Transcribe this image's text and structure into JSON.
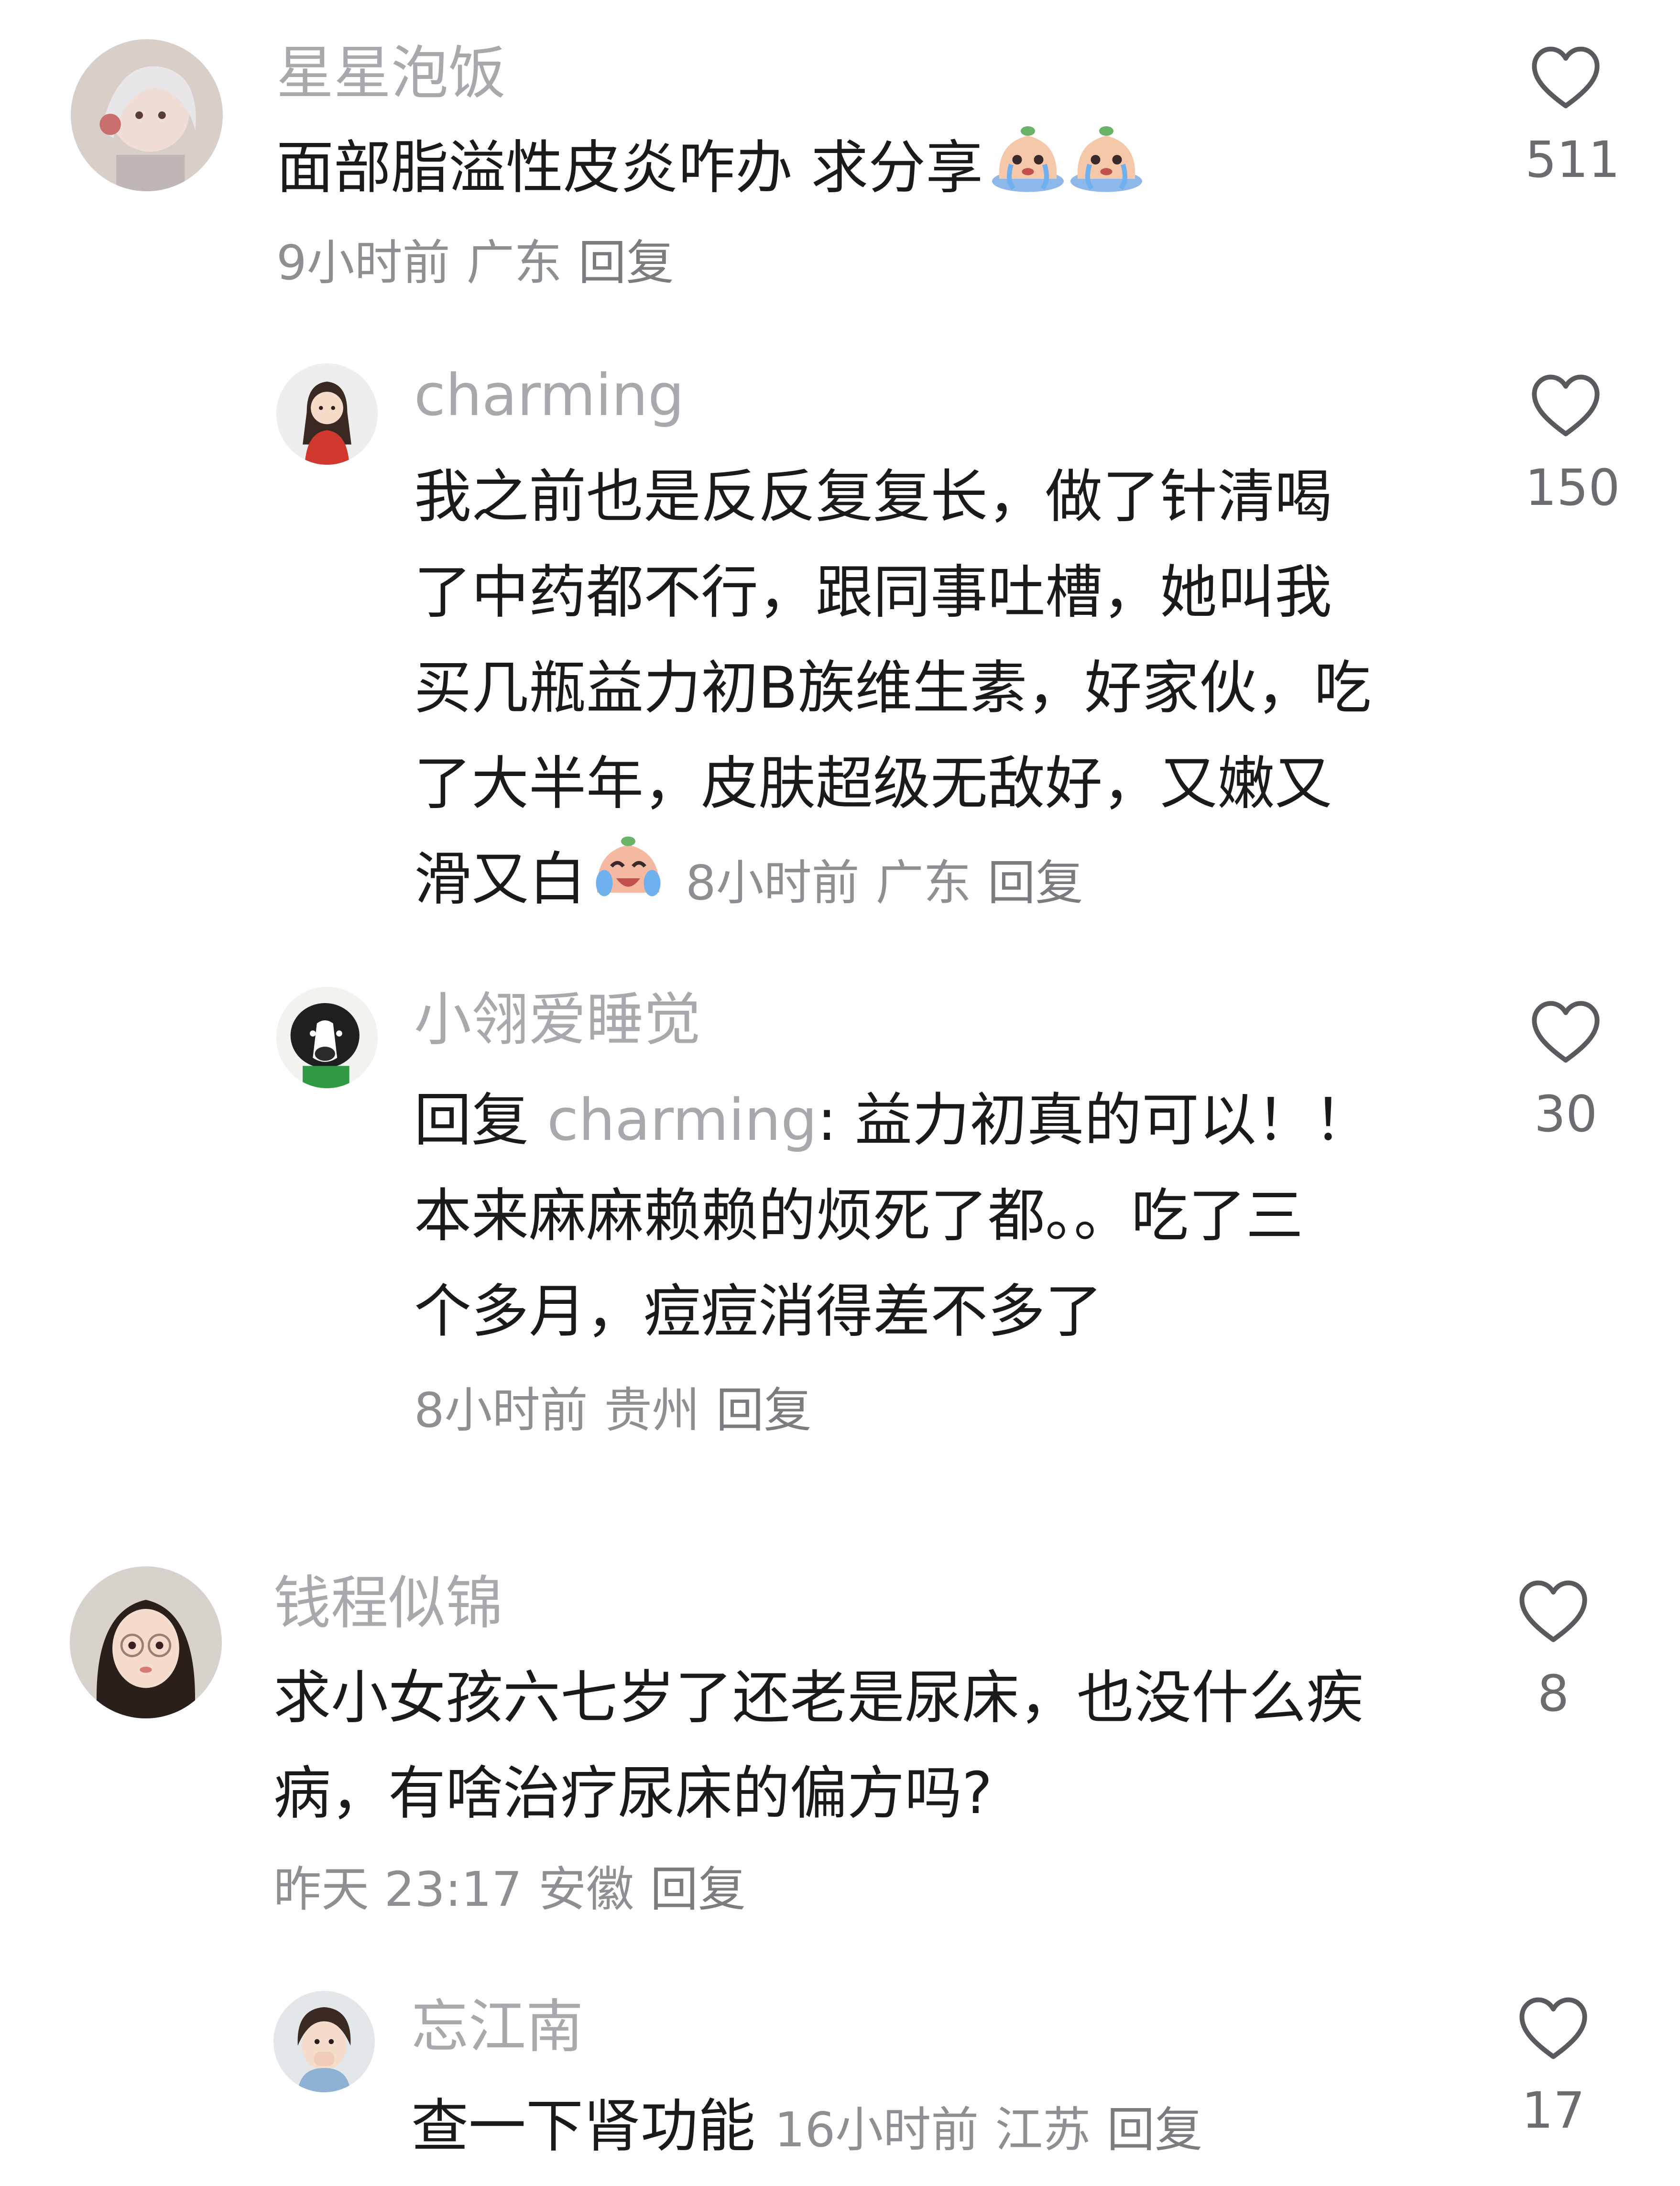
{
  "comments": [
    {
      "username": "星星泡饭",
      "text_lines": [
        "面部脂溢性皮炎咋办 求分享"
      ],
      "emoji": [
        "crying-emoji",
        "crying-emoji"
      ],
      "time": "9小时前",
      "location": "广东",
      "reply_label": "回复",
      "likes": "511"
    },
    {
      "username": "charming",
      "text_lines": [
        "我之前也是反反复复长，做了针清喝",
        "了中药都不行，跟同事吐槽，她叫我",
        "买几瓶益力初B族维生素，好家伙，吃",
        "了大半年，皮肤超级无敌好，又嫩又",
        "滑又白"
      ],
      "emoji": [
        "laugh-cry-emoji"
      ],
      "time": "8小时前",
      "location": "广东",
      "reply_label": "回复",
      "likes": "150"
    },
    {
      "username": "小翎爱睡觉",
      "reply_prefix": "回复",
      "reply_to": "charming",
      "text_lines": [
        ": 益力初真的可以！！",
        "本来麻麻赖赖的烦死了都。。吃了三",
        "个多月，痘痘消得差不多了"
      ],
      "time": "8小时前",
      "location": "贵州",
      "reply_label": "回复",
      "likes": "30"
    },
    {
      "username": "钱程似锦",
      "text_lines": [
        "求小女孩六七岁了还老是尿床，也没什么疾",
        "病，有啥治疗尿床的偏方吗?"
      ],
      "time": "昨天 23:17",
      "location": "安徽",
      "reply_label": "回复",
      "likes": "8"
    },
    {
      "username": "忘江南",
      "text_lines": [
        "查一下肾功能"
      ],
      "time": "16小时前",
      "location": "江苏",
      "reply_label": "回复",
      "likes": "17"
    }
  ],
  "icons": {
    "like": "heart-outline-icon"
  },
  "colors": {
    "username": "#a8a8ad",
    "body_text": "#1a1a1a",
    "meta": "#8e8e93",
    "heart": "#5a5a5e"
  }
}
